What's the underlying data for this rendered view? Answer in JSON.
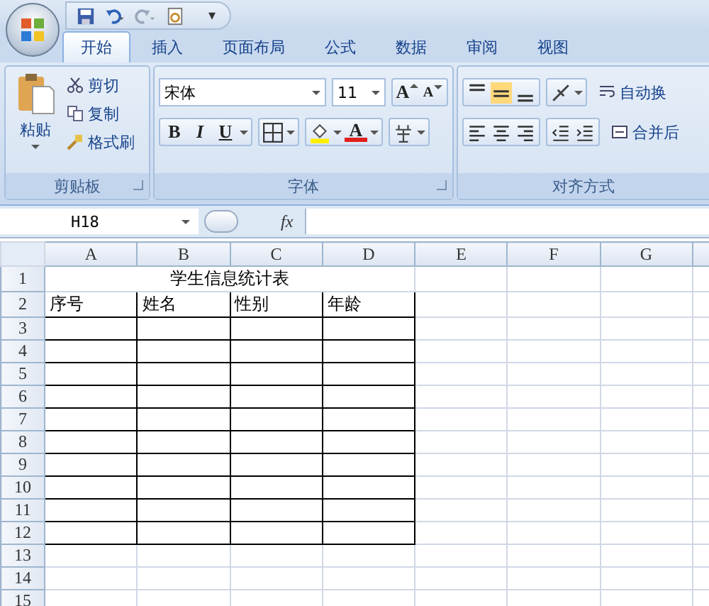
{
  "quick_access_menu": "▾",
  "tabs": [
    {
      "label": "开始",
      "selected": true
    },
    {
      "label": "插入",
      "selected": false
    },
    {
      "label": "页面布局",
      "selected": false
    },
    {
      "label": "公式",
      "selected": false
    },
    {
      "label": "数据",
      "selected": false
    },
    {
      "label": "审阅",
      "selected": false
    },
    {
      "label": "视图",
      "selected": false
    }
  ],
  "clipboard": {
    "paste": "粘贴",
    "cut": "剪切",
    "copy": "复制",
    "format_painter": "格式刷",
    "group_label": "剪贴板"
  },
  "font": {
    "font_name": "宋体",
    "font_size": "11",
    "grow": "A",
    "shrink": "A",
    "bold": "B",
    "italic": "I",
    "underline": "U",
    "font_color": "A",
    "group_label": "字体"
  },
  "alignment": {
    "vertical": [
      {
        "selected": false
      },
      {
        "selected": true
      },
      {
        "selected": false
      }
    ],
    "horizontal": [
      {
        "selected": false
      },
      {
        "selected": false
      },
      {
        "selected": false
      }
    ],
    "wrap_text": "自动换",
    "merge": "合并后",
    "group_label": "对齐方式"
  },
  "formula_bar": {
    "name_box": "H18",
    "fx": "fx"
  },
  "sheet": {
    "columns": [
      "A",
      "B",
      "C",
      "D",
      "E",
      "F",
      "G"
    ],
    "rows": [
      {
        "number": "1",
        "kind": "title",
        "text": "学生信息统计表"
      },
      {
        "number": "2",
        "kind": "header",
        "cells": [
          "序号",
          "姓名",
          "性别",
          "年龄"
        ]
      },
      {
        "number": "3",
        "kind": "bordered"
      },
      {
        "number": "4",
        "kind": "bordered"
      },
      {
        "number": "5",
        "kind": "bordered"
      },
      {
        "number": "6",
        "kind": "bordered"
      },
      {
        "number": "7",
        "kind": "bordered"
      },
      {
        "number": "8",
        "kind": "bordered"
      },
      {
        "number": "9",
        "kind": "bordered"
      },
      {
        "number": "10",
        "kind": "bordered"
      },
      {
        "number": "11",
        "kind": "bordered"
      },
      {
        "number": "12",
        "kind": "bordered"
      },
      {
        "number": "13",
        "kind": "plain"
      },
      {
        "number": "14",
        "kind": "plain"
      },
      {
        "number": "15",
        "kind": "plain"
      }
    ]
  }
}
